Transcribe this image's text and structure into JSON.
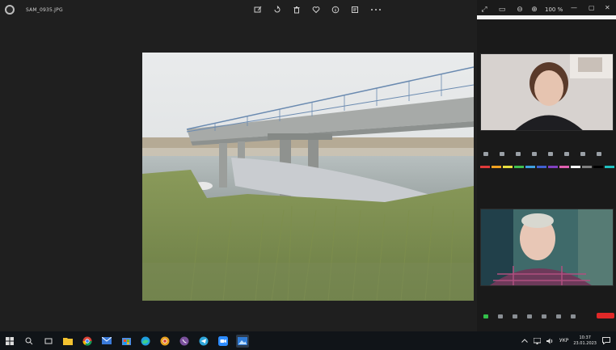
{
  "viewer": {
    "file_name": "SAM_0935.JPG",
    "toolbar": [
      "edit-image",
      "rotate",
      "delete",
      "favorite",
      "info",
      "edit-with",
      "more"
    ]
  },
  "zoom": {
    "zoom_level": "100 %",
    "window_buttons": {
      "minimize": "—",
      "maximize": "▢",
      "close": "✕"
    }
  },
  "taskbar": {
    "language": "УКР",
    "time": "10:37",
    "date": "23.01.2023"
  }
}
